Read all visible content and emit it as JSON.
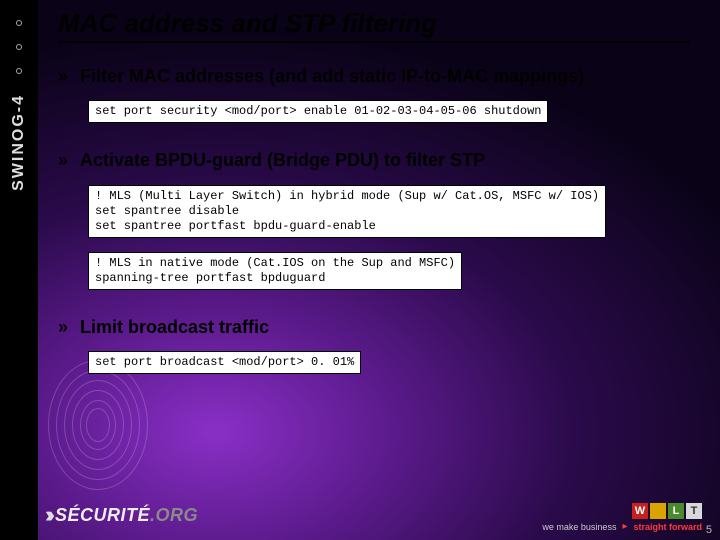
{
  "sidebar": {
    "label": "SWINOG-4"
  },
  "title": "MAC address and STP filtering",
  "sections": [
    {
      "heading": "Filter MAC addresses (and add static IP-to-MAC mappings)",
      "code": [
        "set port security <mod/port> enable 01-02-03-04-05-06 shutdown"
      ]
    },
    {
      "heading": "Activate BPDU-guard (Bridge PDU) to filter STP",
      "code": [
        "! MLS (Multi Layer Switch) in hybrid mode (Sup w/ Cat.OS, MSFC w/ IOS)\nset spantree disable\nset spantree portfast bpdu-guard-enable",
        "! MLS in native mode (Cat.IOS on the Sup and MSFC)\nspanning-tree portfast bpduguard"
      ]
    },
    {
      "heading": "Limit broadcast traffic",
      "code": [
        "set port broadcast <mod/port> 0. 01%"
      ]
    }
  ],
  "footer": {
    "logo_left_brand": "SÉCURITÉ",
    "logo_left_suffix": ".ORG",
    "wlt": [
      "W",
      "L",
      "T"
    ],
    "tagline_plain": "we make business",
    "tagline_em": "straight forward",
    "page": "5"
  }
}
